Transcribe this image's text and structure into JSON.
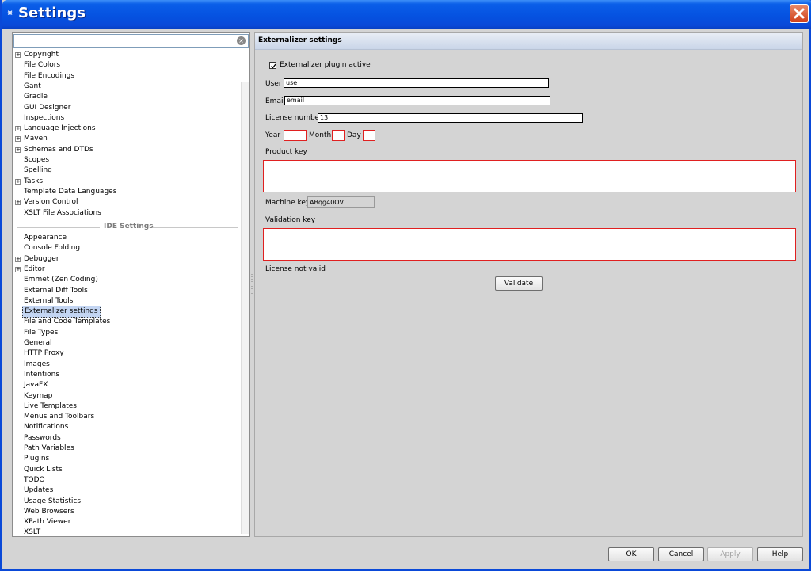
{
  "window": {
    "title": "Settings"
  },
  "left": {
    "search_value": "",
    "project_items": [
      {
        "label": "Copyright",
        "expandable": true
      },
      {
        "label": "File Colors",
        "expandable": false
      },
      {
        "label": "File Encodings",
        "expandable": false
      },
      {
        "label": "Gant",
        "expandable": false
      },
      {
        "label": "Gradle",
        "expandable": false
      },
      {
        "label": "GUI Designer",
        "expandable": false
      },
      {
        "label": "Inspections",
        "expandable": false
      },
      {
        "label": "Language Injections",
        "expandable": true
      },
      {
        "label": "Maven",
        "expandable": true
      },
      {
        "label": "Schemas and DTDs",
        "expandable": true
      },
      {
        "label": "Scopes",
        "expandable": false
      },
      {
        "label": "Spelling",
        "expandable": false
      },
      {
        "label": "Tasks",
        "expandable": true
      },
      {
        "label": "Template Data Languages",
        "expandable": false
      },
      {
        "label": "Version Control",
        "expandable": true
      },
      {
        "label": "XSLT File Associations",
        "expandable": false
      }
    ],
    "ide_section": "IDE Settings",
    "ide_items": [
      {
        "label": "Appearance",
        "expandable": false
      },
      {
        "label": "Console Folding",
        "expandable": false
      },
      {
        "label": "Debugger",
        "expandable": true
      },
      {
        "label": "Editor",
        "expandable": true
      },
      {
        "label": "Emmet (Zen Coding)",
        "expandable": false
      },
      {
        "label": "External Diff Tools",
        "expandable": false
      },
      {
        "label": "External Tools",
        "expandable": false
      },
      {
        "label": "Externalizer settings",
        "expandable": false,
        "selected": true
      },
      {
        "label": "File and Code Templates",
        "expandable": false
      },
      {
        "label": "File Types",
        "expandable": false
      },
      {
        "label": "General",
        "expandable": false
      },
      {
        "label": "HTTP Proxy",
        "expandable": false
      },
      {
        "label": "Images",
        "expandable": false
      },
      {
        "label": "Intentions",
        "expandable": false
      },
      {
        "label": "JavaFX",
        "expandable": false
      },
      {
        "label": "Keymap",
        "expandable": false
      },
      {
        "label": "Live Templates",
        "expandable": false
      },
      {
        "label": "Menus and Toolbars",
        "expandable": false
      },
      {
        "label": "Notifications",
        "expandable": false
      },
      {
        "label": "Passwords",
        "expandable": false
      },
      {
        "label": "Path Variables",
        "expandable": false
      },
      {
        "label": "Plugins",
        "expandable": false
      },
      {
        "label": "Quick Lists",
        "expandable": false
      },
      {
        "label": "TODO",
        "expandable": false
      },
      {
        "label": "Updates",
        "expandable": false
      },
      {
        "label": "Usage Statistics",
        "expandable": false
      },
      {
        "label": "Web Browsers",
        "expandable": false
      },
      {
        "label": "XPath Viewer",
        "expandable": false
      },
      {
        "label": "XSLT",
        "expandable": false
      }
    ]
  },
  "right": {
    "header": "Externalizer settings",
    "plugin_active_label": "Externalizer plugin active",
    "plugin_active": true,
    "user_label": "User",
    "user_value": "use",
    "email_label": "Email",
    "email_value": "email",
    "license_label": "License number",
    "license_value": "13",
    "year_label": "Year",
    "year_value": "",
    "month_label": "Month",
    "month_value": "",
    "day_label": "Day",
    "day_value": "",
    "product_key_label": "Product key",
    "product_key_value": "",
    "machine_key_label": "Machine key",
    "machine_key_value": "ABqg40OV",
    "validation_key_label": "Validation key",
    "validation_key_value": "",
    "status_text": "License not valid",
    "validate_button": "Validate"
  },
  "footer": {
    "ok": "OK",
    "cancel": "Cancel",
    "apply": "Apply",
    "help": "Help"
  },
  "colors": {
    "error_border": "#e02020",
    "selection": "#c3d5f2",
    "titlebar": "#0a49d8"
  }
}
